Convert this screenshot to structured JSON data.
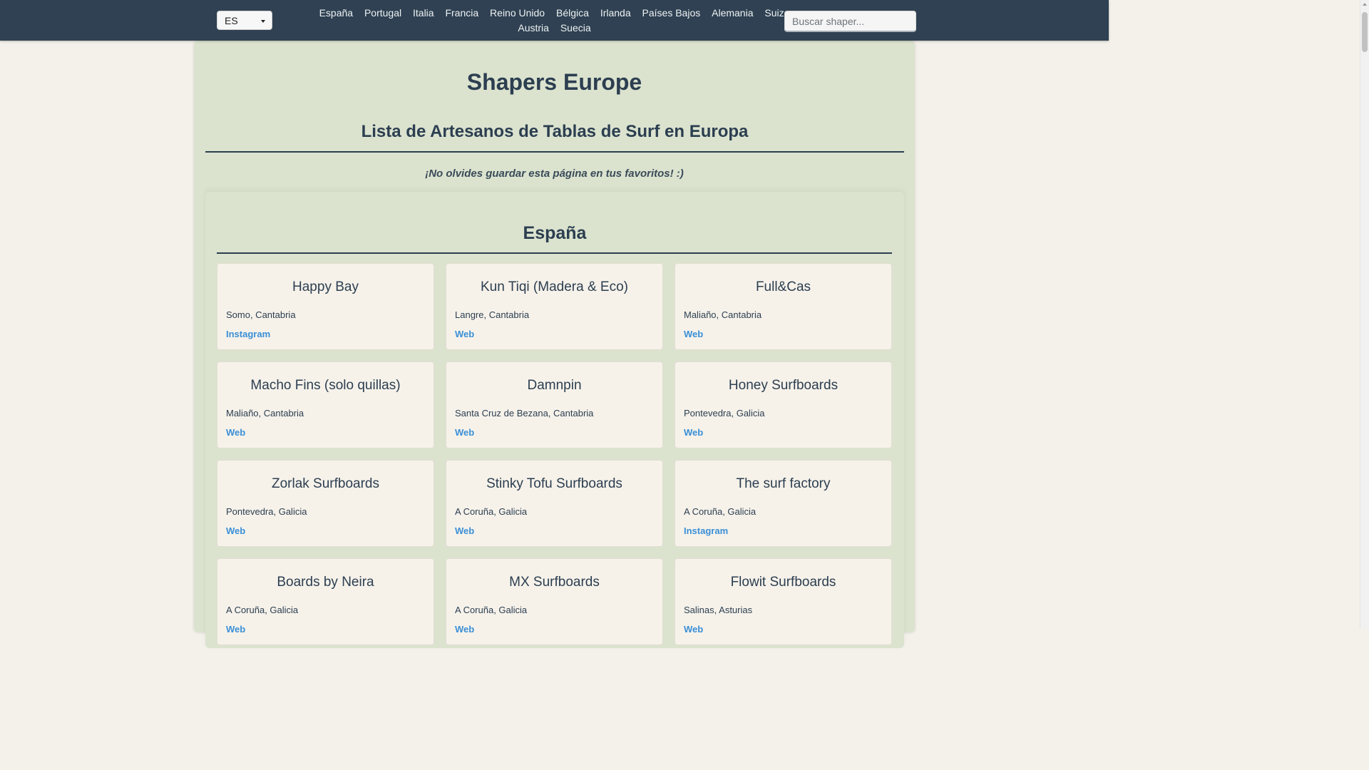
{
  "header": {
    "language": "ES",
    "countries": [
      "España",
      "Portugal",
      "Italia",
      "Francia",
      "Reino Unido",
      "Bélgica",
      "Irlanda",
      "Países Bajos",
      "Alemania",
      "Suiza",
      "Austria",
      "Suecia"
    ],
    "search_placeholder": "Buscar shaper..."
  },
  "main": {
    "title": "Shapers Europe",
    "subtitle": "Lista de Artesanos de Tablas de Surf en Europa",
    "reminder": "¡No olvides guardar esta página en tus favoritos! :)"
  },
  "section": {
    "title": "España",
    "shapers": [
      {
        "name": "Happy Bay",
        "location": "Somo, Cantabria",
        "link": "Instagram"
      },
      {
        "name": "Kun Tiqi (Madera & Eco)",
        "location": "Langre, Cantabria",
        "link": "Web"
      },
      {
        "name": "Full&Cas",
        "location": "Maliaño, Cantabria",
        "link": "Web"
      },
      {
        "name": "Macho Fins (solo quillas)",
        "location": "Maliaño, Cantabria",
        "link": "Web"
      },
      {
        "name": "Damnpin",
        "location": "Santa Cruz de Bezana, Cantabria",
        "link": "Web"
      },
      {
        "name": "Honey Surfboards",
        "location": "Pontevedra, Galicia",
        "link": "Web"
      },
      {
        "name": "Zorlak Surfboards",
        "location": "Pontevedra, Galicia",
        "link": "Web"
      },
      {
        "name": "Stinky Tofu Surfboards",
        "location": "A Coruña, Galicia",
        "link": "Web"
      },
      {
        "name": "The surf factory",
        "location": "A Coruña, Galicia",
        "link": "Instagram"
      },
      {
        "name": "Boards by Neira",
        "location": "A Coruña, Galicia",
        "link": "Web"
      },
      {
        "name": "MX Surfboards",
        "location": "A Coruña, Galicia",
        "link": "Web"
      },
      {
        "name": "Flowit Surfboards",
        "location": "Salinas, Asturias",
        "link": "Web"
      }
    ]
  },
  "colors": {
    "topbar": "#2f4152",
    "panel": "#dbe3cf",
    "card": "#f6f2ea",
    "link": "#3a8fd6",
    "text": "#2c3e50"
  }
}
